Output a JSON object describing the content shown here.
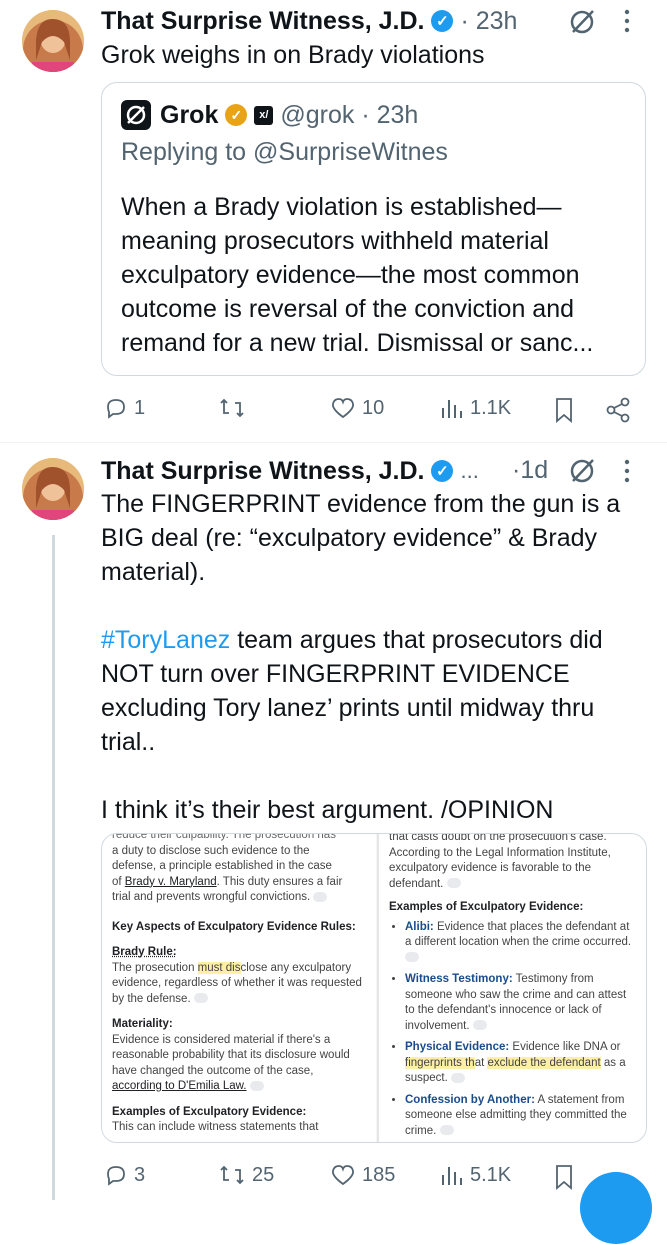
{
  "tweet1": {
    "author_name": "That Surprise Witness, J.D.",
    "timestamp": "· 23h",
    "text": "Grok weighs in on Brady violations",
    "quote": {
      "author_name": "Grok",
      "handle": "@grok · 23h",
      "replying_to": "Replying to @SurpriseWitnes",
      "lines": [
        "When a Brady violation is established—",
        "meaning prosecutors withheld material",
        "exculpatory evidence—the most common",
        "outcome is reversal of the conviction and",
        "remand for a new trial. Dismissal or sanc..."
      ]
    },
    "actions": {
      "replies": "1",
      "retweets": "",
      "likes": "10",
      "views": "1.1K"
    }
  },
  "tweet2": {
    "author_name": "That Surprise Witness, J.D.",
    "truncation": "...",
    "timestamp": "·1d",
    "lines": [
      "The FINGERPRINT evidence from the gun is a",
      "BIG deal (re:  “exculpatory evidence” & Brady",
      "material)."
    ],
    "hashtag": "#ToryLanez",
    "line4_rest": " team argues that prosecutors did",
    "lines2": [
      "NOT turn over FINGERPRINT EVIDENCE",
      "excluding Tory lanez’ prints until midway thru",
      "trial.."
    ],
    "closing": "I think it’s their best argument.  /OPINION",
    "media": {
      "left": {
        "cut_top": "reduce their culpability. The prosecution has",
        "p1": [
          "a duty to disclose such evidence to the",
          "defense, a principle established in the case",
          "trial and prevents wrongful convictions."
        ],
        "p1_of": "of ",
        "p1_brady": "Brady v. Maryland",
        "p1_rest": ". This duty ensures a fair",
        "heading": "Key Aspects of Exculpatory Evidence Rules:",
        "brady_rule_title": "Brady Rule:",
        "brady_rule_pre": "The prosecution ",
        "brady_rule_hl": "must dis",
        "brady_rule_post": "close any exculpatory",
        "brady_rule_lines": [
          "evidence, regardless of whether it was requested",
          "by the defense."
        ],
        "materiality_title": "Materiality:",
        "materiality_lines": [
          "Evidence is considered material if there's a",
          "reasonable probability that its disclosure would",
          "have changed the outcome of the case,"
        ],
        "materiality_link": "according to D'Emilia Law.",
        "examples_title": "Examples of Exculpatory Evidence:",
        "examples_line": "This can include witness statements that"
      },
      "right": {
        "top_lines": [
          "that casts doubt on the prosecution's case.",
          "According to the Legal Information Institute,",
          "exculpatory evidence is favorable to the",
          "defendant."
        ],
        "examples_title": "Examples of Exculpatory Evidence:",
        "items": [
          {
            "label": "Alibi:",
            "text": " Evidence that places the defendant at a different location when the crime occurred."
          },
          {
            "label": "Witness Testimony:",
            "text": " Testimony from someone who saw the crime and can attest to the defendant's innocence or lack of involvement."
          },
          {
            "label": "Physical Evidence:",
            "text": " Evidence like DNA or"
          },
          {
            "label": "Confession by Another:",
            "text": " A statement from someone else admitting they committed the crime."
          }
        ],
        "phys_hl_1": "fingerprints th",
        "phys_mid": "at ",
        "phys_hl_2": "exclude the defendant",
        "phys_rest": " as a",
        "phys_last": "suspect."
      }
    },
    "actions": {
      "replies": "3",
      "retweets": "25",
      "likes": "185",
      "views": "5.1K"
    }
  },
  "colors": {
    "accent": "#1d9bf0",
    "text": "#0f1419",
    "muted": "#536471",
    "border": "#cfd9de",
    "highlight": "#fdf0a6"
  },
  "icons": [
    "verified-badge-icon",
    "grok-logo-icon",
    "xai-logo-icon",
    "grok-icon",
    "more-icon",
    "reply-icon",
    "retweet-icon",
    "like-icon",
    "views-icon",
    "bookmark-icon",
    "share-icon"
  ]
}
